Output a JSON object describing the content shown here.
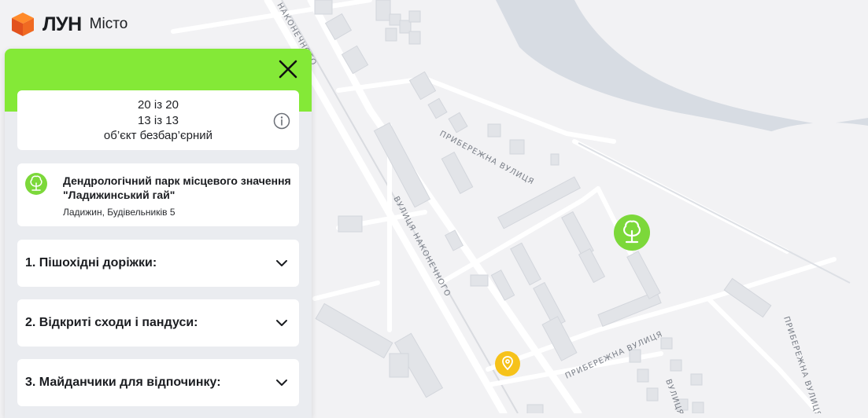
{
  "app": {
    "brand": "ЛУН",
    "product": "Місто"
  },
  "colors": {
    "accent": "#84e937",
    "park_marker": "#7cd83a",
    "poi_marker": "#f6c21a",
    "water": "#d7dce3",
    "map_background": "#f2f2f4"
  },
  "map": {
    "streets": [
      "ВУЛИЦЯ НАКОНЕЧНОГО",
      "ПРИБЕРЕЖНА ВУЛИЦЯ",
      "ПРИБЕРЕЖНА ВУЛИЦЯ",
      "ПРИБЕРЕЖНА ВУЛИЦЯ",
      "НАКОНЕЧНОГО",
      "ВУЛИЦЯ"
    ],
    "markers": [
      {
        "type": "park",
        "icon": "tree-icon"
      },
      {
        "type": "poi",
        "icon": "location-pin-icon"
      }
    ]
  },
  "panel": {
    "score": {
      "line1": "20 із 20",
      "line2": "13 із 13",
      "line3": "об’єкт безбар’єрний",
      "info_icon": "info-icon"
    },
    "place": {
      "icon": "tree-icon",
      "name": "Дендрологічний парк місцевого значення \"Ладижинський гай\"",
      "address": "Ладижин, Будівельників 5"
    },
    "sections": [
      {
        "label": "1. Пішохідні доріжки:"
      },
      {
        "label": "2. Відкриті сходи і пандуси:"
      },
      {
        "label": "3. Майданчики для відпочинку:"
      }
    ],
    "close_icon": "close-icon",
    "chevron_icon": "chevron-down-icon"
  }
}
